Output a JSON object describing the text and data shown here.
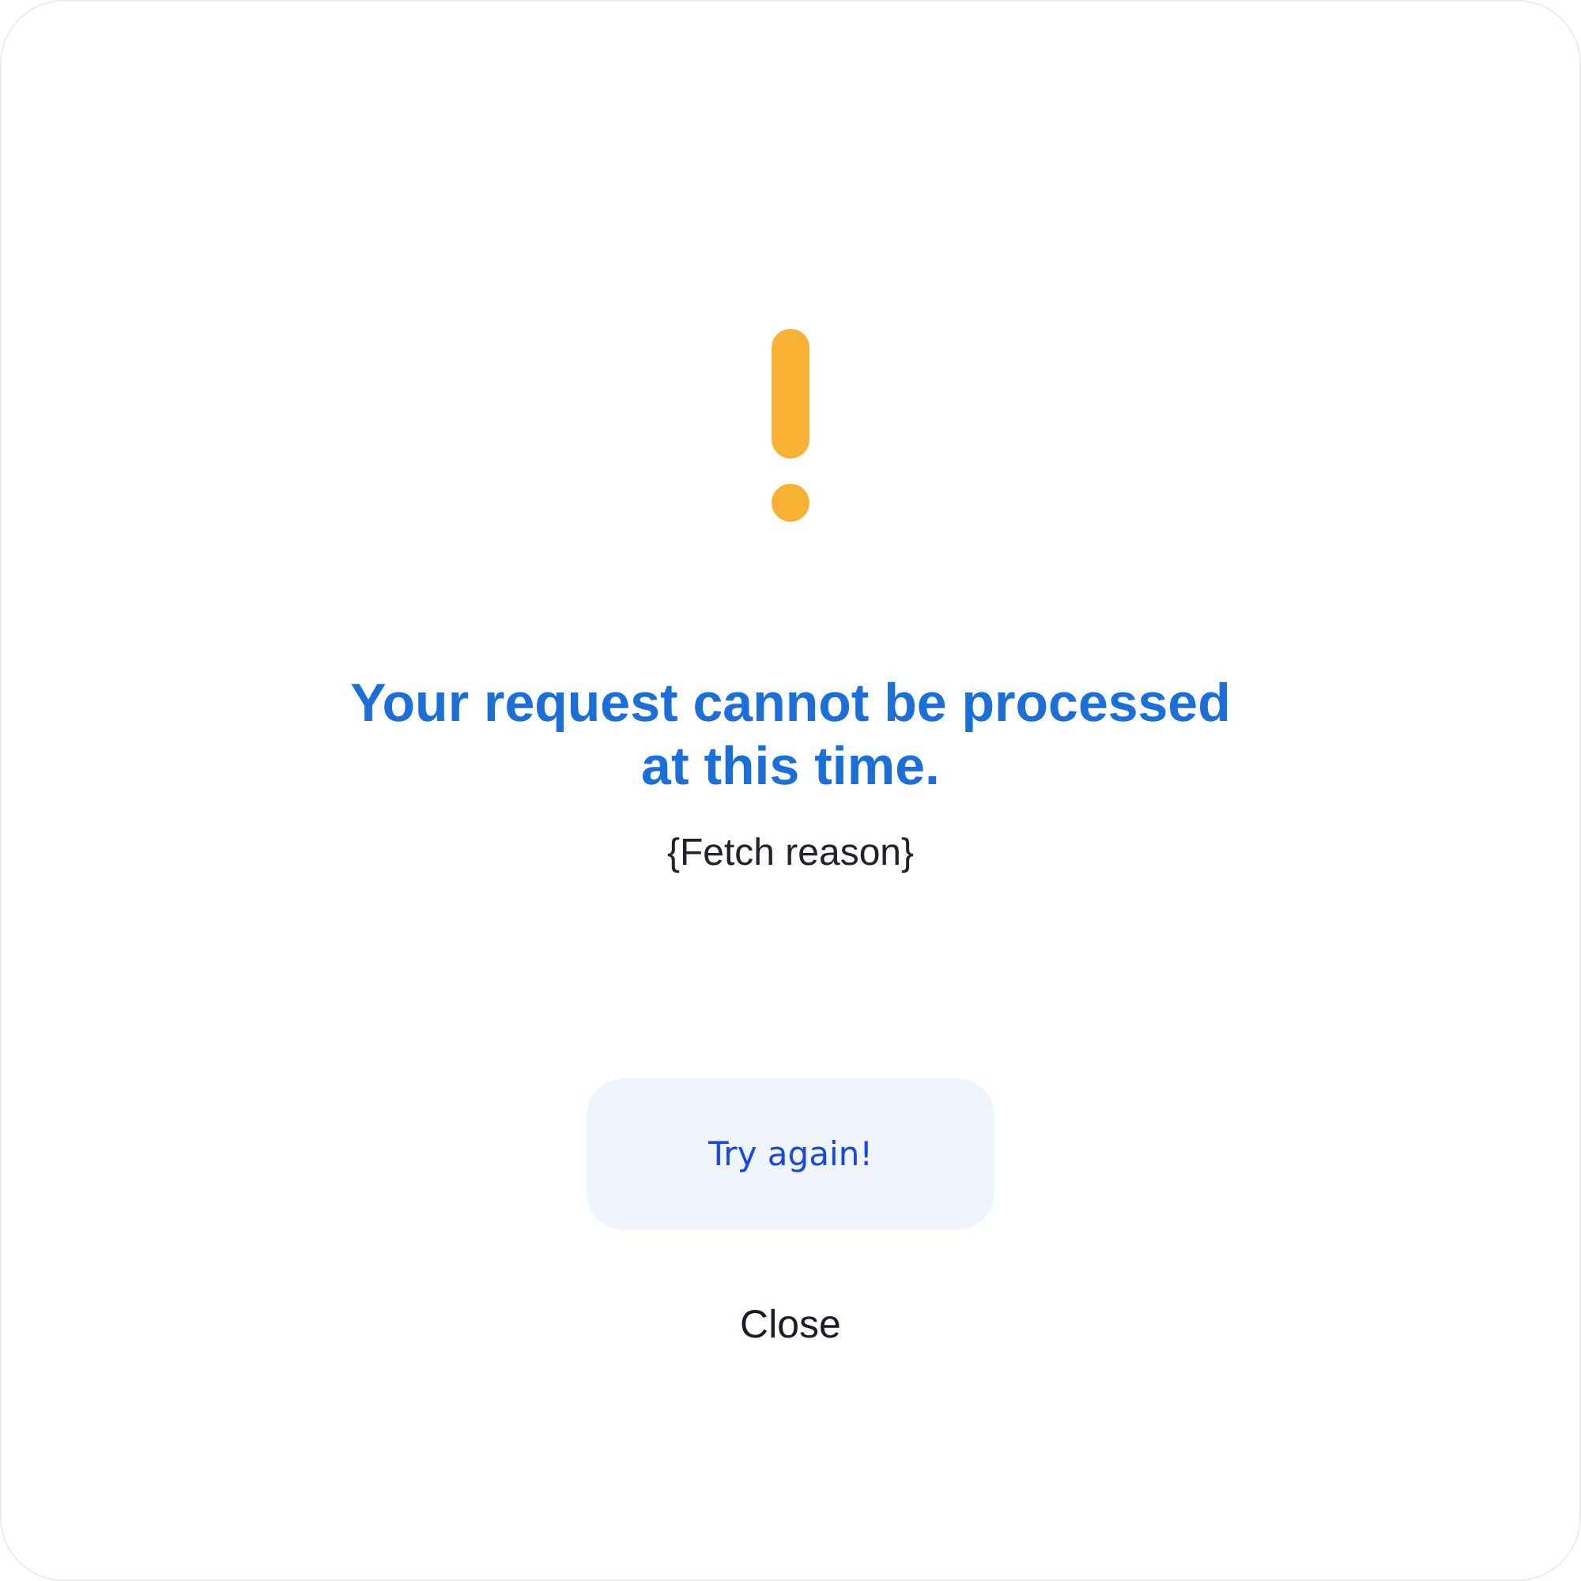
{
  "dialog": {
    "title": "Your request cannot be processed at this time.",
    "message": "{Fetch reason}",
    "buttons": [
      {
        "label": "Try again!",
        "kind": "primary"
      },
      {
        "label": "Close",
        "kind": "text"
      }
    ]
  }
}
